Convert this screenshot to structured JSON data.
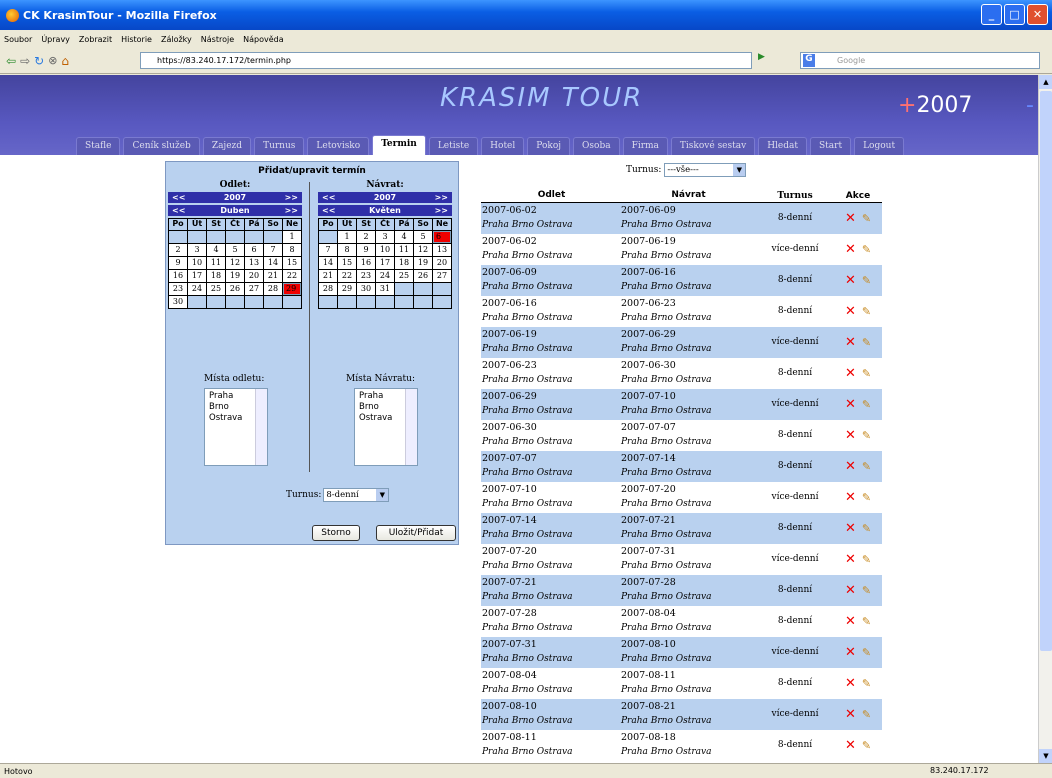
{
  "window": {
    "title": "CK KrasimTour - Mozilla Firefox"
  },
  "menu": [
    "Soubor",
    "Úpravy",
    "Zobrazit",
    "Historie",
    "Záložky",
    "Nástroje",
    "Nápověda"
  ],
  "url": "https://83.240.17.172/termin.php",
  "search_placeholder": "Google",
  "banner": {
    "logo": "KRASIM TOUR",
    "year": "2007",
    "year_prefix": "+",
    "year_suffix": "-"
  },
  "tabs": [
    "Stafle",
    "Ceník služeb",
    "Zajezd",
    "Turnus",
    "Letovisko",
    "Termin",
    "Letiste",
    "Hotel",
    "Pokoj",
    "Osoba",
    "Firma",
    "Tiskové sestav",
    "Hledat",
    "Start",
    "Logout"
  ],
  "active_tab": "Termin",
  "form": {
    "title": "Přidat/upravit termín",
    "odlet_label": "Odlet:",
    "navrat_label": "Návrat:",
    "odlet_year": "2007",
    "odlet_month": "Duben",
    "navrat_year": "2007",
    "navrat_month": "Květen",
    "prev": "<<",
    "next": ">>",
    "weekdays": [
      "Po",
      "Út",
      "St",
      "Čt",
      "Pá",
      "So",
      "Ne"
    ],
    "odlet_days": [
      "",
      "",
      "",
      "",
      "",
      "",
      "1",
      "2",
      "3",
      "4",
      "5",
      "6",
      "7",
      "8",
      "9",
      "10",
      "11",
      "12",
      "13",
      "14",
      "15",
      "16",
      "17",
      "18",
      "19",
      "20",
      "21",
      "22",
      "23",
      "24",
      "25",
      "26",
      "27",
      "28",
      "29",
      "30",
      "",
      "",
      "",
      "",
      "",
      ""
    ],
    "odlet_selected": "29",
    "navrat_days": [
      "",
      "1",
      "2",
      "3",
      "4",
      "5",
      "6",
      "7",
      "8",
      "9",
      "10",
      "11",
      "12",
      "13",
      "14",
      "15",
      "16",
      "17",
      "18",
      "19",
      "20",
      "21",
      "22",
      "23",
      "24",
      "25",
      "26",
      "27",
      "28",
      "29",
      "30",
      "31",
      "",
      "",
      "",
      "",
      "",
      "",
      "",
      "",
      "",
      ""
    ],
    "navrat_selected": "6",
    "mista_odletu_label": "Místa odletu:",
    "mista_navratu_label": "Místa Návratu:",
    "mista_odletu": [
      "Praha",
      "Brno",
      "Ostrava"
    ],
    "mista_navratu": [
      "Praha",
      "Brno",
      "Ostrava"
    ],
    "turnus_label": "Turnus:",
    "turnus_value": "8-denní",
    "cancel": "Storno",
    "save": "Uložit/Přidat"
  },
  "filter": {
    "label": "Turnus:",
    "value": "---vše---"
  },
  "table": {
    "headers": [
      "Odlet",
      "Návrat",
      "Turnus",
      "Akce"
    ],
    "rows": [
      {
        "odlet": "2007-06-02",
        "navrat": "2007-06-09",
        "turnus": "8-denní"
      },
      {
        "odlet": "2007-06-02",
        "navrat": "2007-06-19",
        "turnus": "více-denní"
      },
      {
        "odlet": "2007-06-09",
        "navrat": "2007-06-16",
        "turnus": "8-denní"
      },
      {
        "odlet": "2007-06-16",
        "navrat": "2007-06-23",
        "turnus": "8-denní"
      },
      {
        "odlet": "2007-06-19",
        "navrat": "2007-06-29",
        "turnus": "více-denní"
      },
      {
        "odlet": "2007-06-23",
        "navrat": "2007-06-30",
        "turnus": "8-denní"
      },
      {
        "odlet": "2007-06-29",
        "navrat": "2007-07-10",
        "turnus": "více-denní"
      },
      {
        "odlet": "2007-06-30",
        "navrat": "2007-07-07",
        "turnus": "8-denní"
      },
      {
        "odlet": "2007-07-07",
        "navrat": "2007-07-14",
        "turnus": "8-denní"
      },
      {
        "odlet": "2007-07-10",
        "navrat": "2007-07-20",
        "turnus": "více-denní"
      },
      {
        "odlet": "2007-07-14",
        "navrat": "2007-07-21",
        "turnus": "8-denní"
      },
      {
        "odlet": "2007-07-20",
        "navrat": "2007-07-31",
        "turnus": "více-denní"
      },
      {
        "odlet": "2007-07-21",
        "navrat": "2007-07-28",
        "turnus": "8-denní"
      },
      {
        "odlet": "2007-07-28",
        "navrat": "2007-08-04",
        "turnus": "8-denní"
      },
      {
        "odlet": "2007-07-31",
        "navrat": "2007-08-10",
        "turnus": "více-denní"
      },
      {
        "odlet": "2007-08-04",
        "navrat": "2007-08-11",
        "turnus": "8-denní"
      },
      {
        "odlet": "2007-08-10",
        "navrat": "2007-08-21",
        "turnus": "více-denní"
      },
      {
        "odlet": "2007-08-11",
        "navrat": "2007-08-18",
        "turnus": "8-denní"
      }
    ],
    "places": "Praha Brno Ostrava"
  },
  "status": {
    "text": "Hotovo",
    "ip": "83.240.17.172"
  }
}
